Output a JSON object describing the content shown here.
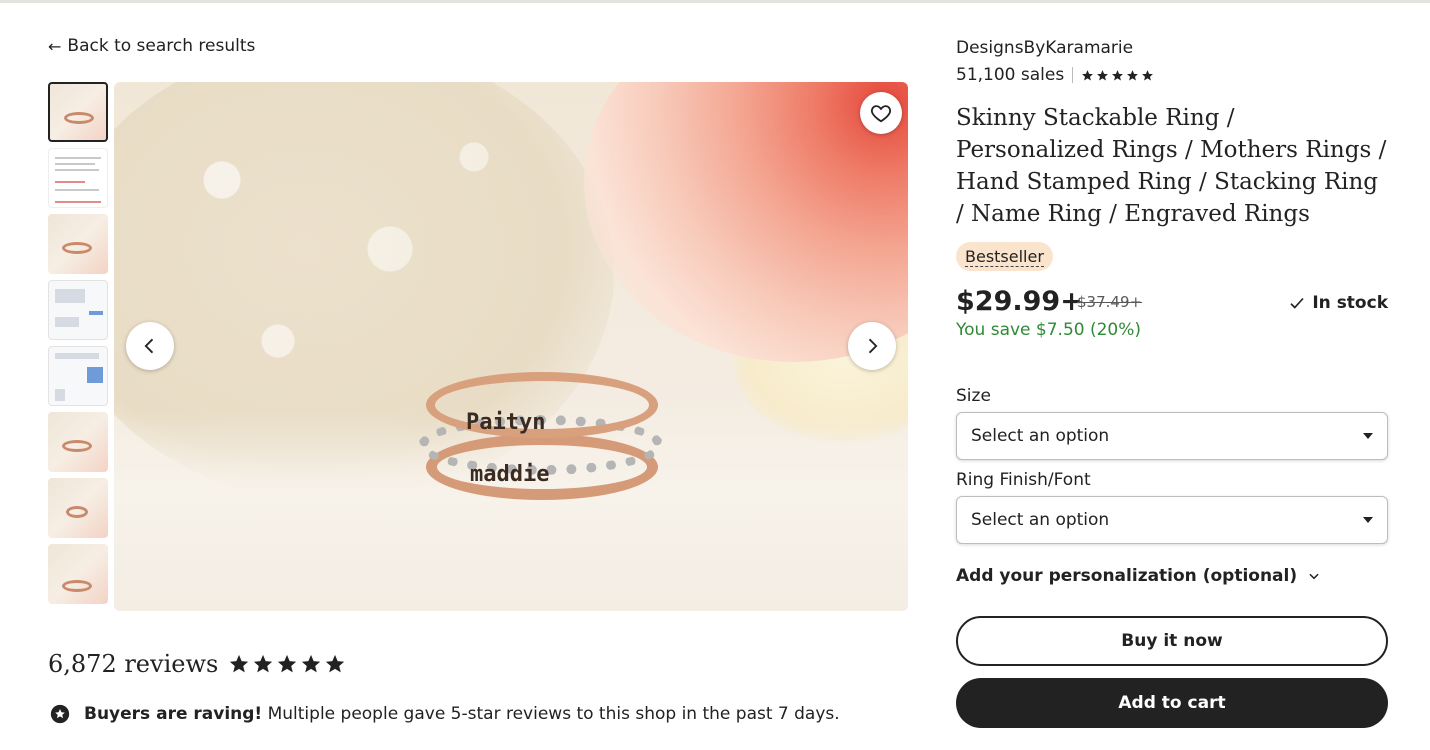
{
  "nav": {
    "back_label": "Back to search results"
  },
  "shop": {
    "name": "DesignsByKaramarie",
    "sales": "51,100 sales",
    "rating_stars": 5
  },
  "product": {
    "title": "Skinny Stackable Ring / Personalized Rings / Mothers Rings / Hand Stamped Ring / Stacking Ring / Name Ring / Engraved Rings",
    "badge": "Bestseller",
    "price": "$29.99+",
    "original_price": "$37.49+",
    "stock": "In stock",
    "savings": "You save $7.50 (20%)"
  },
  "gallery": {
    "thumbnail_count": 8,
    "engraving_top": "Paityn",
    "engraving_bottom": "maddie"
  },
  "options": {
    "size_label": "Size",
    "size_value": "Select an option",
    "finish_label": "Ring Finish/Font",
    "finish_value": "Select an option"
  },
  "personalization": {
    "label": "Add your personalization (optional)"
  },
  "actions": {
    "buy_now": "Buy it now",
    "add_to_cart": "Add to cart"
  },
  "reviews": {
    "count": "6,872 reviews",
    "rating_stars": 5,
    "raving_bold": "Buyers are raving!",
    "raving_text": "Multiple people gave 5-star reviews to this shop in the past 7 days."
  },
  "colors": {
    "accent": "#222222",
    "savings_green": "#2f8a36",
    "badge_bg": "#fbe4cd"
  }
}
